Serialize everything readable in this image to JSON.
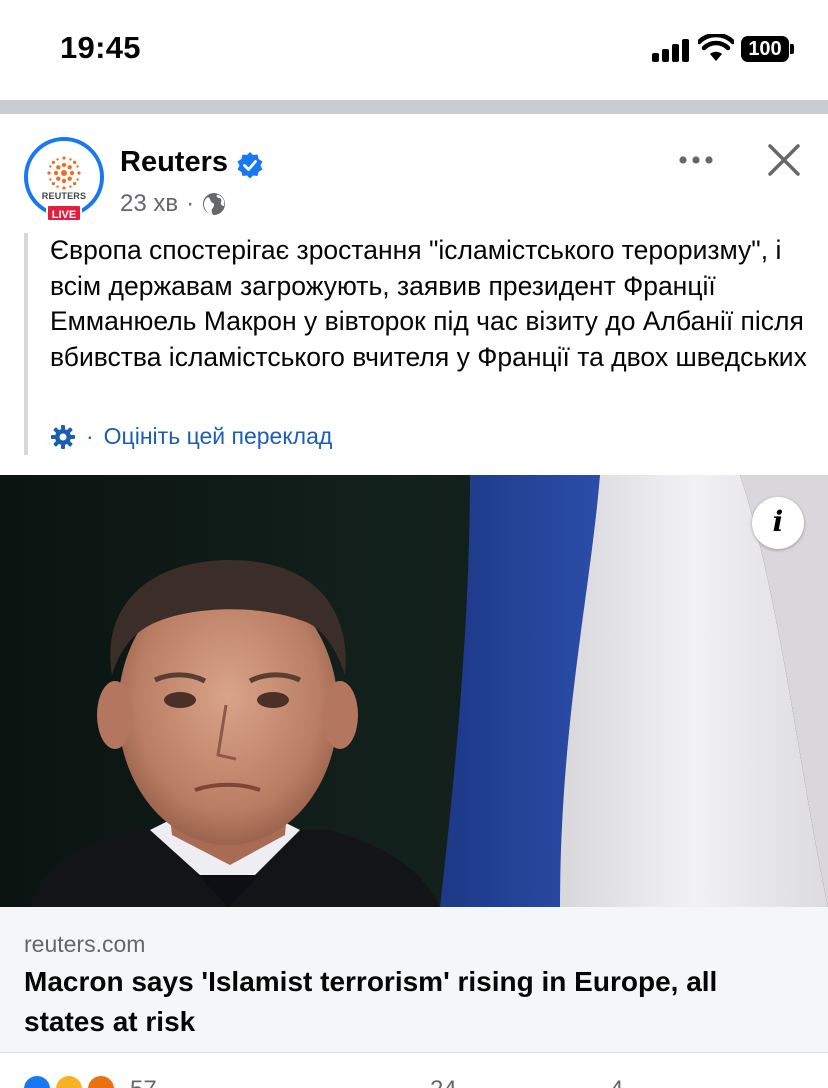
{
  "status_bar": {
    "time": "19:45",
    "battery": "100",
    "icons": [
      "signal-icon",
      "wifi-icon",
      "battery-icon"
    ]
  },
  "post": {
    "page_name": "Reuters",
    "avatar_text": "REUTERS",
    "live_badge": "LIVE",
    "time_ago": "23 хв",
    "meta_separator": "·",
    "audience_icon": "globe-icon",
    "verified_icon": "verified-badge-icon",
    "text": "Європа спостерігає зростання \"ісламістського тероризму\", і всім державам загрожують, заявив президент Франції Емманюель Макрон у вівторок під час візиту до Албанії після вбивства ісламістського вчителя у Франції та двох шведських",
    "translate_separator": "·",
    "translate_label": "Оцініть цей переклад"
  },
  "link_card": {
    "domain": "reuters.com",
    "title": "Macron says 'Islamist terrorism' rising in Europe, all states at risk",
    "info_icon_label": "i"
  },
  "reactions": {
    "count": "57",
    "comments": "24",
    "shares": "4"
  },
  "colors": {
    "accent": "#1877f2",
    "link": "#1b5fb5",
    "secondary_text": "#65676b",
    "live": "#e41e3f",
    "divider": "#c9ccd1"
  }
}
